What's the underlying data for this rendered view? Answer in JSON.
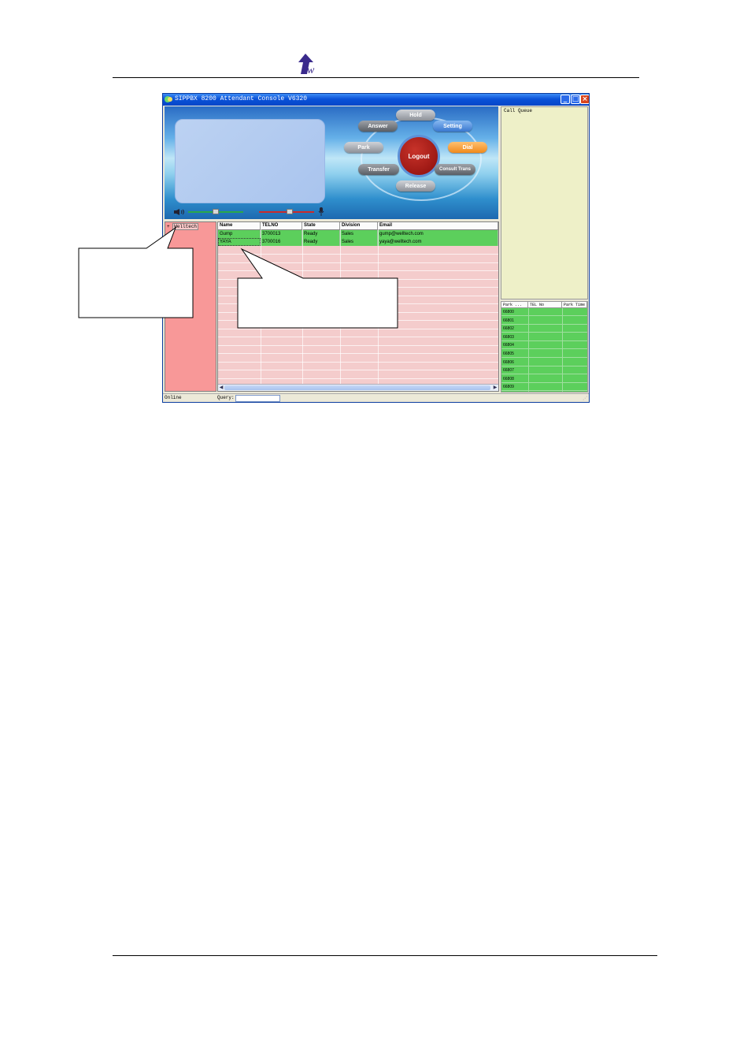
{
  "window": {
    "title": "SIPPBX 8200 Attendant Console V6320",
    "controls": [
      "_",
      "□",
      "×"
    ]
  },
  "buttons": {
    "hold": "Hold",
    "answer": "Answer",
    "setting": "Setting",
    "park": "Park",
    "logout": "Logout",
    "dial": "Dial",
    "transfer": "Transfer",
    "consult_trans": "Consult Trans",
    "release": "Release"
  },
  "volume": {
    "speaker_level": 0.5,
    "mic_level": 0.55
  },
  "tree": {
    "expander": "+",
    "root": "Welltech"
  },
  "contacts": {
    "columns": [
      "Name",
      "TELNO",
      "State",
      "Division",
      "Email"
    ],
    "rows": [
      [
        "Gump",
        "3700013",
        "Ready",
        "Sales",
        "gump@welltech.com"
      ],
      [
        "YAYA",
        "3700016",
        "Ready",
        "Sales",
        "yaya@welltech.com"
      ]
    ]
  },
  "call_queue": {
    "title": "Call Queue"
  },
  "park_table": {
    "columns": [
      "Park ...",
      "TEL No",
      "Park Time"
    ],
    "rows": [
      "66800",
      "66801",
      "66802",
      "66803",
      "66804",
      "66805",
      "66806",
      "66807",
      "66808",
      "66809"
    ]
  },
  "statusbar": {
    "status": "Online",
    "query_label": "Query:",
    "query_value": ""
  },
  "colors": {
    "titlebar": "#0a52d8",
    "grid_row": "#5ccf5c",
    "tree_bg": "#f89898",
    "queue_bg": "#eef0c8"
  }
}
